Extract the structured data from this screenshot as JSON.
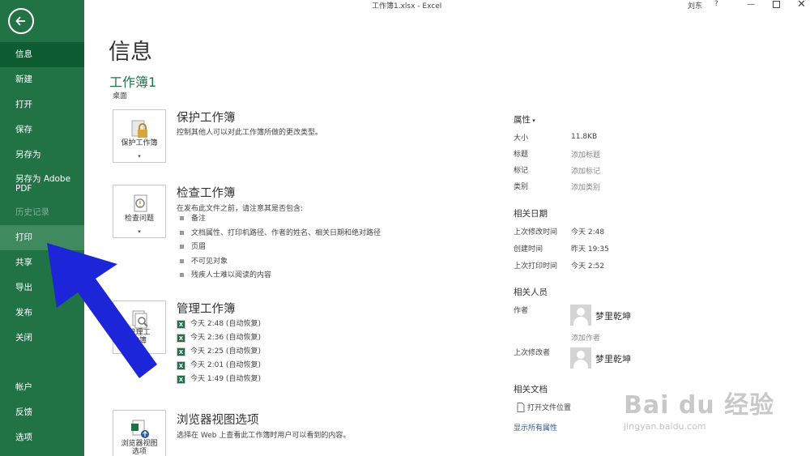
{
  "titlebar": {
    "doc_title": "工作簿1.xlsx  -  Excel",
    "user": "刘东",
    "help": "?",
    "minimize": "—",
    "close": "✕"
  },
  "sidebar": {
    "items": [
      {
        "label": "信息"
      },
      {
        "label": "新建"
      },
      {
        "label": "打开"
      },
      {
        "label": "保存"
      },
      {
        "label": "另存为"
      },
      {
        "label": "另存为 Adobe",
        "label2": "PDF"
      },
      {
        "label": "历史记录"
      },
      {
        "label": "打印"
      },
      {
        "label": "共享"
      },
      {
        "label": "导出"
      },
      {
        "label": "发布"
      },
      {
        "label": "关闭"
      },
      {
        "label": "帐户"
      },
      {
        "label": "反馈"
      },
      {
        "label": "选项"
      }
    ]
  },
  "main": {
    "heading": "信息",
    "workbook_name": "工作簿1",
    "location": "桌面",
    "protect": {
      "button_label": "保护工作簿",
      "title": "保护工作簿",
      "desc": "控制其他人可以对此工作簿所做的更改类型。"
    },
    "inspect": {
      "button_label": "检查问题",
      "title": "检查工作簿",
      "desc": "在发布此文件之前，请注意其是否包含:",
      "bullets": [
        "备注",
        "文档属性、打印机路径、作者的姓名、相关日期和绝对路径",
        "页眉",
        "不可见对象",
        "残疾人士难以阅读的内容"
      ]
    },
    "manage": {
      "button_label_1": "管理工",
      "button_label_2": "作簿",
      "title": "管理工作簿",
      "versions": [
        "今天 2:48 (自动恢复)",
        "今天 2:36 (自动恢复)",
        "今天 2:25 (自动恢复)",
        "今天 2:01 (自动恢复)",
        "今天 1:49 (自动恢复)"
      ]
    },
    "browser": {
      "button_label_1": "浏览器视图",
      "button_label_2": "选项",
      "title": "浏览器视图选项",
      "desc": "选择在 Web 上查看此工作簿时用户可以看到的内容。"
    }
  },
  "properties": {
    "heading": "属性",
    "rows": [
      {
        "label": "大小",
        "value": "11.8KB"
      },
      {
        "label": "标题",
        "value": "添加标题"
      },
      {
        "label": "标记",
        "value": "添加标记"
      },
      {
        "label": "类别",
        "value": "添加类别"
      }
    ],
    "dates_heading": "相关日期",
    "dates": [
      {
        "label": "上次修改时间",
        "value": "今天 2:48"
      },
      {
        "label": "创建时间",
        "value": "昨天 19:35"
      },
      {
        "label": "上次打印时间",
        "value": "今天 2:52"
      }
    ],
    "people_heading": "相关人员",
    "author_label": "作者",
    "author_name": "梦里乾坤",
    "add_author": "添加作者",
    "modifier_label": "上次修改者",
    "modifier_name": "梦里乾坤",
    "docs_heading": "相关文档",
    "open_location": "打开文件位置",
    "show_all": "显示所有属性"
  },
  "watermark": {
    "logo": "Bai du 经验",
    "url": "jingyan.baidu.com"
  },
  "colors": {
    "accent": "#217346",
    "sidebar_selected": "#0e5c32",
    "arrow": "#1c26d8"
  }
}
